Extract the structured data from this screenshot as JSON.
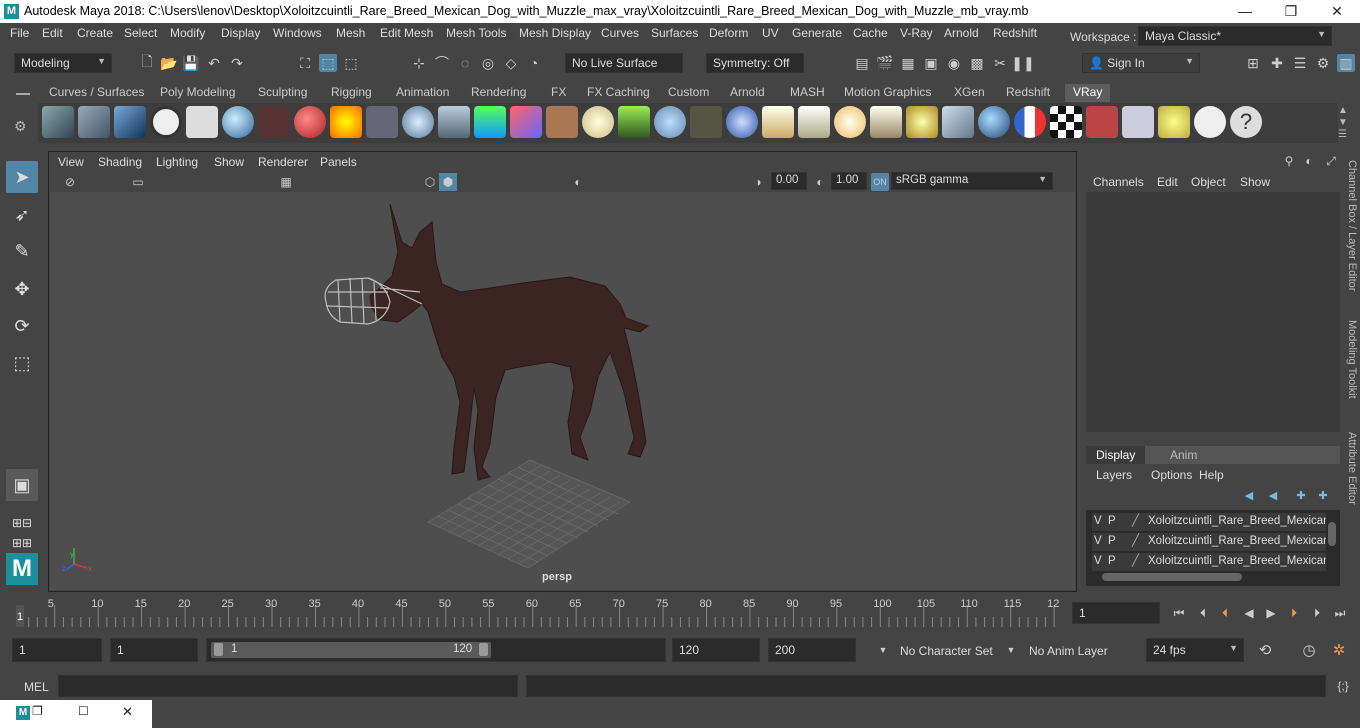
{
  "window": {
    "title": "Autodesk Maya 2018: C:\\Users\\lenov\\Desktop\\Xoloitzcuintli_Rare_Breed_Mexican_Dog_with_Muzzle_max_vray\\Xoloitzcuintli_Rare_Breed_Mexican_Dog_with_Muzzle_mb_vray.mb",
    "minimize": "—",
    "maximize": "❐",
    "close": "✕"
  },
  "menubar": {
    "items": [
      "File",
      "Edit",
      "Create",
      "Select",
      "Modify",
      "Display",
      "Windows",
      "Mesh",
      "Edit Mesh",
      "Mesh Tools",
      "Mesh Display",
      "Curves",
      "Surfaces",
      "Deform",
      "UV",
      "Generate",
      "Cache",
      "V-Ray",
      "Arnold",
      "Redshift"
    ],
    "workspace_label": "Workspace :",
    "workspace_value": "Maya Classic*"
  },
  "statusline": {
    "mode": "Modeling",
    "live_surface": "No Live Surface",
    "symmetry": "Symmetry: Off",
    "sign_in": "Sign In"
  },
  "shelf": {
    "tabs": [
      "Curves / Surfaces",
      "Poly Modeling",
      "Sculpting",
      "Rigging",
      "Animation",
      "Rendering",
      "FX",
      "FX Caching",
      "Custom",
      "Arnold",
      "MASH",
      "Motion Graphics",
      "XGen",
      "Redshift",
      "VRay"
    ],
    "active_tab": "VRay"
  },
  "viewport": {
    "menu": [
      "View",
      "Shading",
      "Lighting",
      "Show",
      "Renderer",
      "Panels"
    ],
    "exposure": "0.00",
    "gamma": "1.00",
    "color_space": "sRGB gamma",
    "camera_label": "persp"
  },
  "channelbox": {
    "menu": [
      "Channels",
      "Edit",
      "Object",
      "Show"
    ],
    "side_tabs": [
      "Channel Box / Layer Editor",
      "Modeling Toolkit",
      "Attribute Editor"
    ]
  },
  "layers": {
    "tabs": [
      "Display",
      "Anim"
    ],
    "active_tab": "Display",
    "menu": [
      "Layers",
      "Options",
      "Help"
    ],
    "rows": [
      {
        "v": "V",
        "p": "P",
        "name": "Xoloitzcuintli_Rare_Breed_Mexican"
      },
      {
        "v": "V",
        "p": "P",
        "name": "Xoloitzcuintli_Rare_Breed_Mexican"
      },
      {
        "v": "V",
        "p": "P",
        "name": "Xoloitzcuintli_Rare_Breed_Mexican"
      }
    ]
  },
  "timeline": {
    "ticks": [
      "5",
      "10",
      "15",
      "20",
      "25",
      "30",
      "35",
      "40",
      "45",
      "50",
      "55",
      "60",
      "65",
      "70",
      "75",
      "80",
      "85",
      "90",
      "95",
      "100",
      "105",
      "110",
      "115",
      "12"
    ],
    "start_marker": "1",
    "current_frame": "1"
  },
  "range": {
    "start": "1",
    "anim_start": "1",
    "slider_start": "1",
    "slider_end": "120",
    "anim_end": "120",
    "end": "200",
    "character_set": "No Character Set",
    "anim_layer": "No Anim Layer",
    "fps": "24 fps"
  },
  "commandline": {
    "label": "MEL"
  }
}
